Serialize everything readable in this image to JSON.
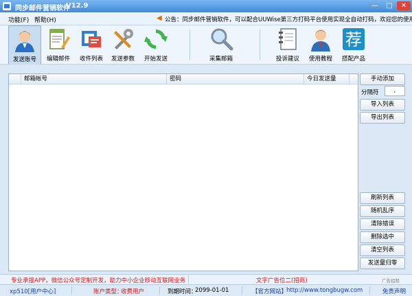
{
  "window": {
    "title": "同步邮件营销软件",
    "version": "V12.9",
    "controls": {
      "minimize": "—",
      "maximize": "□",
      "close": "✕"
    }
  },
  "menu": {
    "function": "功能(F)",
    "help": "帮助(H)",
    "notice": "公告：同步邮件营销软件，可以配合UUWise第三方打码平台使用实现全自动打码，欢迎您的使用！"
  },
  "toolbar": {
    "send_account": "发送账号",
    "edit_mail": "编辑邮件",
    "recipient_list": "收件列表",
    "send_params": "发送参数",
    "start_send": "开始发送",
    "collect_mail": "采集邮箱",
    "feedback": "投诉建议",
    "tutorial": "使用教程",
    "recommend": "搭配产品",
    "recommend_glyph": "荐"
  },
  "table": {
    "columns": [
      "邮箱帐号",
      "密码",
      "今日发送量"
    ],
    "rows": []
  },
  "side": {
    "manual_add": "手动添加",
    "separator_label": "分隔符",
    "separator_value": ",",
    "import_list": "导入列表",
    "export_list": "导出列表",
    "refresh_list": "刷新列表",
    "shuffle": "随机乱序",
    "clear_errors": "清除错误",
    "delete_selected": "删除选中",
    "clear_list": "清空列表",
    "reset_count": "发送量归零"
  },
  "ads": {
    "left": "专业承接APP，微信公众号定制开发，助力中小企业移动互联网业务",
    "right": "文字广告位二(招商)",
    "corner": "广告招租"
  },
  "status": {
    "user": "xp510[用户中心]",
    "account_type_label": "账户类型：",
    "account_type": "收费用户",
    "expire_label": "到期时间：",
    "expire": "2099-01-01",
    "site_label": "【官方网站】",
    "url": "http://www.tongbugw.com",
    "disclaimer": "免责声明"
  },
  "colors": {
    "accent_red": "#d21a1a",
    "link_blue": "#1a3ea8",
    "titlebar": "#3f8ad9"
  }
}
